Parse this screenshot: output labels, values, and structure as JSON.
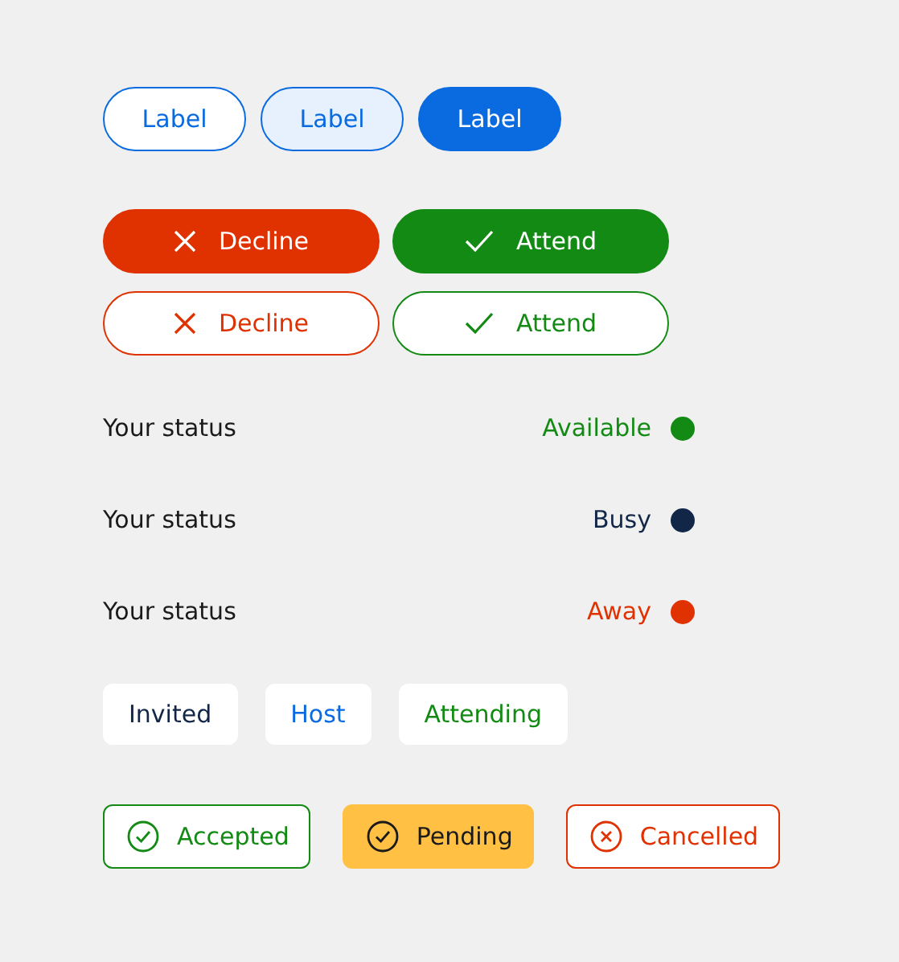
{
  "chips": [
    {
      "label": "Label",
      "kind": "outline"
    },
    {
      "label": "Label",
      "kind": "tinted"
    },
    {
      "label": "Label",
      "kind": "filled"
    }
  ],
  "actions": [
    [
      {
        "label": "Decline",
        "kind": "decline",
        "filled": true,
        "color": "#e03100"
      },
      {
        "label": "Attend",
        "kind": "attend",
        "filled": true,
        "color": "#138a14"
      }
    ],
    [
      {
        "label": "Decline",
        "kind": "decline",
        "filled": false,
        "color": "#e03100"
      },
      {
        "label": "Attend",
        "kind": "attend",
        "filled": false,
        "color": "#138a14"
      }
    ]
  ],
  "statuses": [
    {
      "label": "Your status",
      "value": "Available",
      "color": "#138a14"
    },
    {
      "label": "Your status",
      "value": "Busy",
      "color": "#122647"
    },
    {
      "label": "Your status",
      "value": "Away",
      "color": "#e03100"
    }
  ],
  "tags": [
    {
      "label": "Invited",
      "color": "#122647"
    },
    {
      "label": "Host",
      "color": "#0a6be0"
    },
    {
      "label": "Attending",
      "color": "#138a14"
    }
  ],
  "badges": [
    {
      "label": "Accepted",
      "kind": "positive",
      "filled": false,
      "color": "#138a14"
    },
    {
      "label": "Pending",
      "kind": "positive",
      "filled": true,
      "color": "#ffc043"
    },
    {
      "label": "Cancelled",
      "kind": "negative",
      "filled": false,
      "color": "#e03100"
    }
  ]
}
